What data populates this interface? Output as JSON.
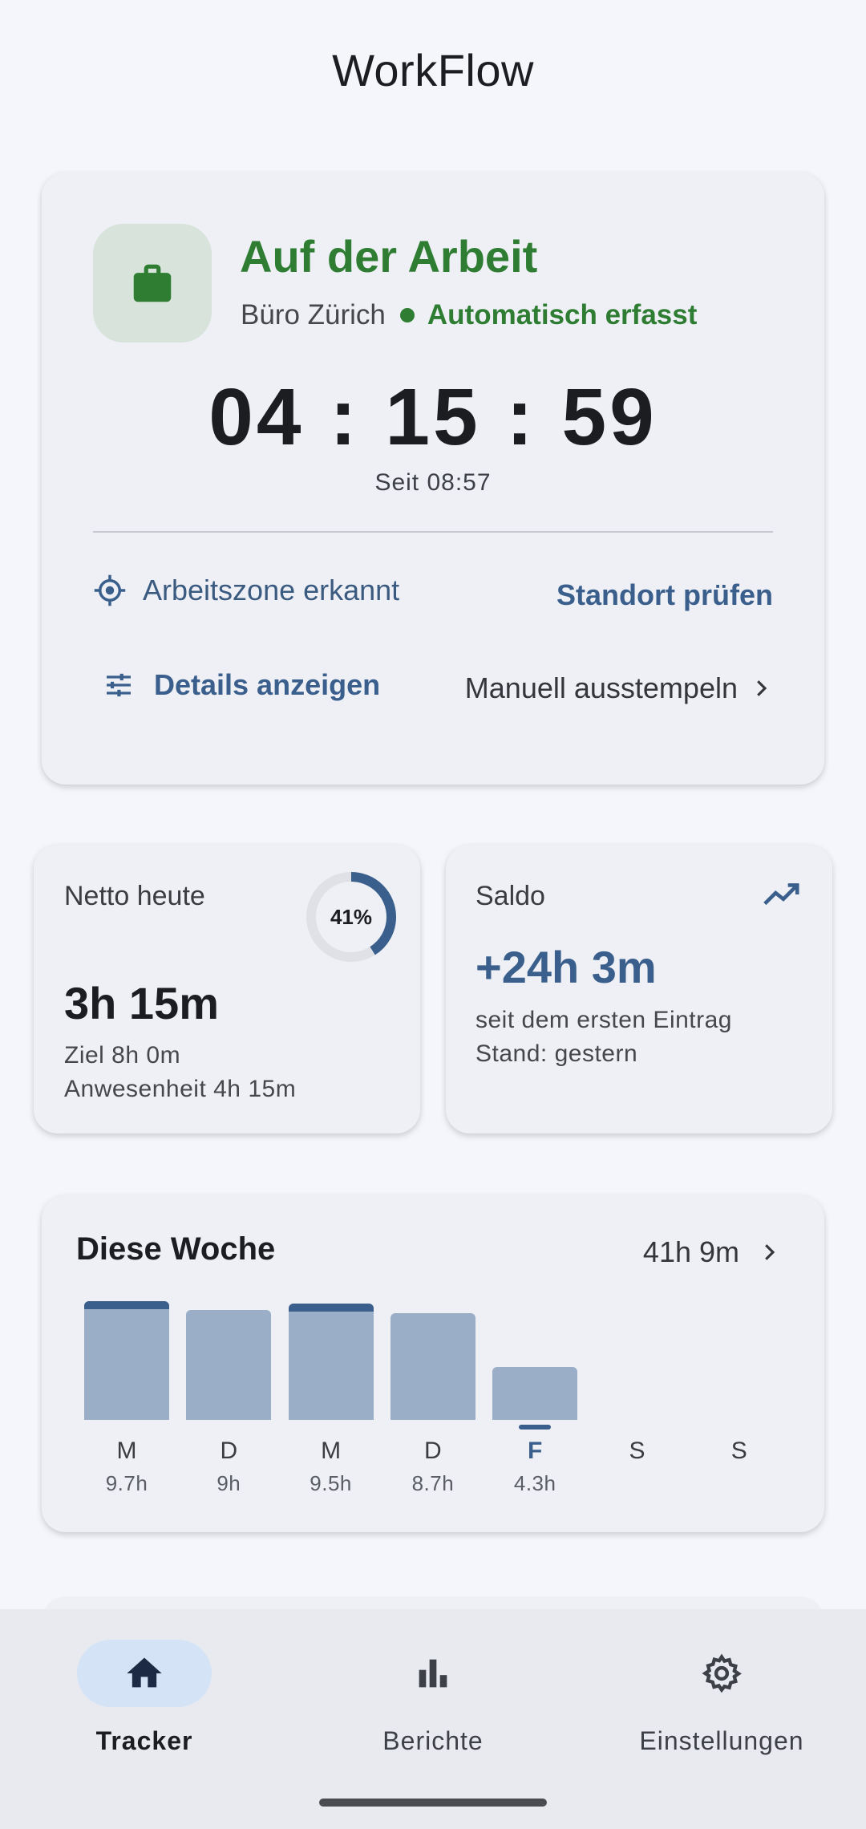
{
  "app": {
    "title": "WorkFlow"
  },
  "status": {
    "title": "Auf der Arbeit",
    "location": "Büro Zürich",
    "tracking_mode": "Automatisch erfasst",
    "timer": "04 : 15 : 59",
    "since": "Seit 08:57",
    "zone_text": "Arbeitszone erkannt",
    "check_location_label": "Standort prüfen",
    "details_label": "Details anzeigen",
    "manual_clockout_label": "Manuell ausstempeln",
    "icon": "briefcase-icon",
    "accent_color": "#2e7d32"
  },
  "netto": {
    "label": "Netto heute",
    "progress_percent": 41,
    "progress_text": "41%",
    "value": "3h 15m",
    "goal": "Ziel 8h 0m",
    "presence": "Anwesenheit 4h 15m"
  },
  "saldo": {
    "label": "Saldo",
    "value": "+24h 3m",
    "since_text": "seit dem ersten Eintrag",
    "stand": "Stand: gestern",
    "icon": "trending-up-icon"
  },
  "week": {
    "title": "Diese Woche",
    "total": "41h 9m",
    "days": [
      {
        "day": "M",
        "hours_label": "9.7h",
        "hours": 9.7,
        "over_target": true
      },
      {
        "day": "D",
        "hours_label": "9h",
        "hours": 9,
        "over_target": false
      },
      {
        "day": "M",
        "hours_label": "9.5h",
        "hours": 9.5,
        "over_target": true
      },
      {
        "day": "D",
        "hours_label": "8.7h",
        "hours": 8.7,
        "over_target": false
      },
      {
        "day": "F",
        "hours_label": "4.3h",
        "hours": 4.3,
        "over_target": false,
        "today": true
      },
      {
        "day": "S",
        "hours_label": "",
        "hours": 0,
        "over_target": false
      },
      {
        "day": "S",
        "hours_label": "",
        "hours": 0,
        "over_target": false
      }
    ]
  },
  "nav": {
    "items": [
      {
        "label": "Tracker",
        "icon": "home-icon",
        "active": true
      },
      {
        "label": "Berichte",
        "icon": "bar-chart-icon",
        "active": false
      },
      {
        "label": "Einstellungen",
        "icon": "gear-icon",
        "active": false
      }
    ]
  },
  "colors": {
    "primary": "#3a5f8c",
    "bar": "#9aaec8",
    "background": "#f5f6fb",
    "card": "#eef0f5"
  }
}
